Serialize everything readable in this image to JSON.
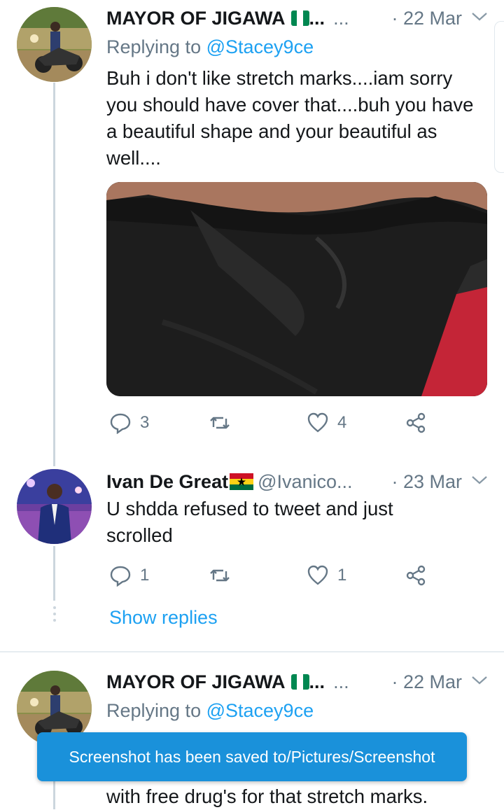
{
  "tweets": [
    {
      "name": "MAYOR OF JIGAWA",
      "truncation": "...",
      "date": "· 22 Mar",
      "replying_prefix": "Replying to",
      "replying_to": "@Stacey9ce",
      "text": "Buh i don't like stretch marks....iam sorry you should have cover that....buh you have a beautiful shape and your beautiful as well....",
      "reply_count": "3",
      "retweet_count": "",
      "like_count": "4",
      "flag_colors": [
        "#008751",
        "#ffffff",
        "#008751"
      ]
    },
    {
      "name": "Ivan De Great",
      "handle": "@Ivanico...",
      "date": "· 23 Mar",
      "text": "U shdda refused to tweet and just scrolled",
      "reply_count": "1",
      "retweet_count": "",
      "like_count": "1",
      "flag_colors": [
        "#ce1126",
        "#fcd116",
        "#006b3f"
      ]
    },
    {
      "name": "MAYOR OF JIGAWA",
      "truncation": "...",
      "date": "· 22 Mar",
      "replying_prefix": "Replying to",
      "replying_to": "@Stacey9ce",
      "text_partial": "Iam sorry I don't mean to insult you if you're in Abuja DM me I will supply you with free drug's for that stretch marks."
    }
  ],
  "thread": {
    "show_replies_label": "Show replies"
  },
  "toast": {
    "message": "Screenshot has been saved to/Pictures/Screenshot"
  },
  "colors": {
    "accent": "#1da1f2",
    "muted": "#657786",
    "text": "#14171a",
    "toast_bg": "#1a91da"
  }
}
